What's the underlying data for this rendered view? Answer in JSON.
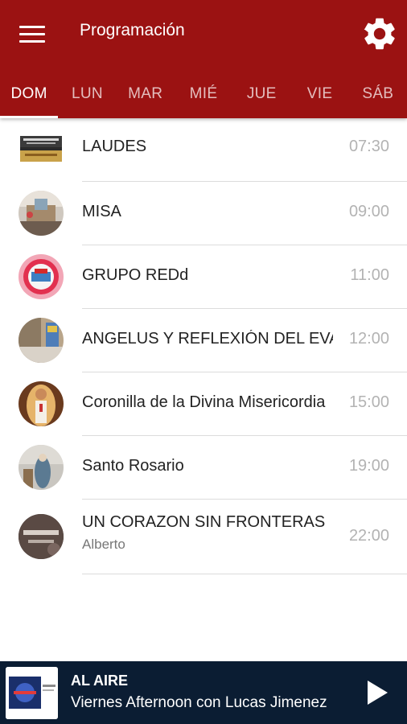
{
  "header": {
    "title": "Programación",
    "menu_icon": "hamburger-menu-icon",
    "settings_icon": "gear-icon",
    "background_color": "#9b1212"
  },
  "tabs": [
    {
      "label": "DOM",
      "active": true
    },
    {
      "label": "LUN",
      "active": false
    },
    {
      "label": "MAR",
      "active": false
    },
    {
      "label": "MIÉ",
      "active": false
    },
    {
      "label": "JUE",
      "active": false
    },
    {
      "label": "VIE",
      "active": false
    },
    {
      "label": "SÁB",
      "active": false
    }
  ],
  "schedule": [
    {
      "title": "LAUDES",
      "subtitle": "",
      "time": "07:30"
    },
    {
      "title": "MISA",
      "subtitle": "",
      "time": "09:00"
    },
    {
      "title": "GRUPO REDd",
      "subtitle": "",
      "time": "11:00"
    },
    {
      "title": "ANGELUS Y REFLEXIÓN DEL EVANGELIO",
      "subtitle": "",
      "time": "12:00"
    },
    {
      "title": "Coronilla de la Divina Misericordia",
      "subtitle": "",
      "time": "15:00"
    },
    {
      "title": "Santo Rosario",
      "subtitle": "",
      "time": "19:00"
    },
    {
      "title": "UN CORAZON SIN FRONTERAS",
      "subtitle": "Alberto",
      "time": "22:00"
    }
  ],
  "player": {
    "status": "AL AIRE",
    "show": "Viernes Afternoon con Lucas Jimenez",
    "play_icon": "play-icon",
    "background_color": "#0b1d33"
  }
}
